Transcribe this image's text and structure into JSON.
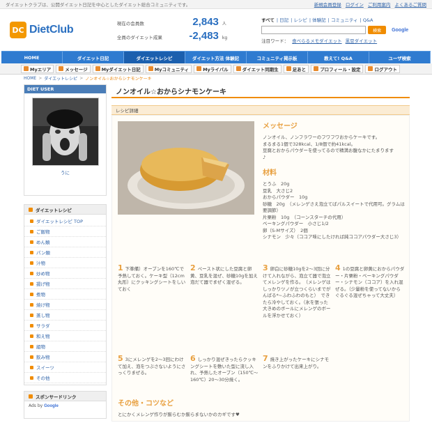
{
  "topbar": {
    "tagline": "ダイエットクラブは、公開ダイエット日記を中心としたダイエット総合コミュニティです。",
    "links": [
      "新規会員登録",
      "ログイン",
      "ご利用案内",
      "よくあるご質問"
    ]
  },
  "header": {
    "logo_mark": "DC",
    "logo_text": "DietClub",
    "stat1_label": "現在の会員数",
    "stat1_value": "2,843",
    "stat1_unit": "人",
    "stat2_label": "全員のダイエット成果",
    "stat2_value": "-2,483",
    "stat2_unit": "kg",
    "search_tabs": [
      "すべて",
      "日記",
      "レシピ",
      "体験記",
      "コミュニティ",
      "Q&A"
    ],
    "search_button": "検索",
    "google_label": "Google",
    "hot_label": "注目ワード：",
    "hot_words": [
      "食べらるメモダイエット",
      "黒豆ダイエット"
    ]
  },
  "mainnav": [
    "HOME",
    "ダイエット日記",
    "ダイエットレシピ",
    "ダイエット方法 体験記",
    "コミュニティ掲示板",
    "教えて! Q&A",
    "ユーザ検索"
  ],
  "subnav": [
    "Myエリア",
    "メッセージ",
    "Myダイエット日記",
    "Myコミュニティ",
    "Myライバル",
    "ダイエット同期生",
    "足あと",
    "プロフィール・設定",
    "ログアウト"
  ],
  "breadcrumb": [
    "HOME",
    "ダイエットレシピ",
    "ノンオイル☆おからシナモンケーキ"
  ],
  "left": {
    "user_title": "DIET USER",
    "user_name": "うに",
    "recipe_title": "ダイエットレシピ",
    "categories": [
      "ダイエットレシピ TOP",
      "ご飯物",
      "めん類",
      "パン類",
      "汁物",
      "炒め物",
      "揚げ物",
      "煮物",
      "焼け物",
      "蒸し物",
      "サラダ",
      "和え物",
      "組物",
      "飲み物",
      "スイーツ",
      "その他"
    ],
    "sponsor_title": "スポンサードリンク",
    "ads_label": "Ads by",
    "ads_brand": "Google"
  },
  "recipe": {
    "title": "ノンオイル☆おからシナモンケーキ",
    "detail_label": "レシピ詳細",
    "message_title": "メッセージ",
    "message": [
      "ノンオイル、ノンフラワーのフワフワおからケーキです。",
      "まるまる1個で328kcal、1/8個で約41kcal。",
      "豆腐とおからパウダーを使ってるので精満お腹なかにたまります",
      "♪"
    ],
    "ingredients_title": "材料",
    "ingredients": [
      "とうふ　20g",
      "豆乳　大さじ2",
      "おからパウダー　10g",
      "砂糖　20g　（メレンゲさえ泡立てばパルスイートで代用可。グラムは要調節）",
      "片栗粉　10g　（コーンスターチの代用）",
      "ベーキングパウダー　小さじ1/2",
      "卵（S-Mサイズ）　2個",
      "シナモン　少々（ココア味にしたければ純ココアパウダー大さじ3）"
    ],
    "steps": [
      {
        "n": "1",
        "t": "下準備）オーブンを160℃で予熱しておく。ケーキ型（12cm丸形）にクッキングシートをしいておく"
      },
      {
        "n": "2",
        "t": "ペースト状にした豆腐と卵黄、豆乳を混ぜ、砂糖10gを加え泡だて器でまぜく混ぜる。"
      },
      {
        "n": "3",
        "t": "卵白に砂糖10gを2～3回に分けて入れながら、泡立て器で泡立てメレンゲを作る。　（メレンゲはしっかりツノが立つくらいまでがんばる*~ふわふわのもと）　できたら冷やしておく。（氷を張った大きめのボールにメレンゲのボールを浮かせておく）"
      },
      {
        "n": "4",
        "t": "1の豆腐と卵黄におからパウダー・片栗粉・ベーキングパウダー・シナモン（ココア）を入れ混ぜる。（少量粉を使ってないからぐるぐる混ぜちゃって大丈夫）"
      },
      {
        "n": "5",
        "t": "3にメレンゲを2～3回にわけて加え、泡をつぶさないようにさっくりまぜる。"
      },
      {
        "n": "6",
        "t": "しっかり混ぜきったらクッキングシートを敷いた型に流し入れ、予熱したオーブン（150℃～160℃）20～30分焼く。"
      },
      {
        "n": "7",
        "t": "焼き上がったケーキにシナモンをふりかけて出来上がり。"
      }
    ],
    "other_title": "その他・コツなど",
    "other_text": "とにかくメレンゲ作りが膨らむか膨らまないかのカギです♥"
  }
}
